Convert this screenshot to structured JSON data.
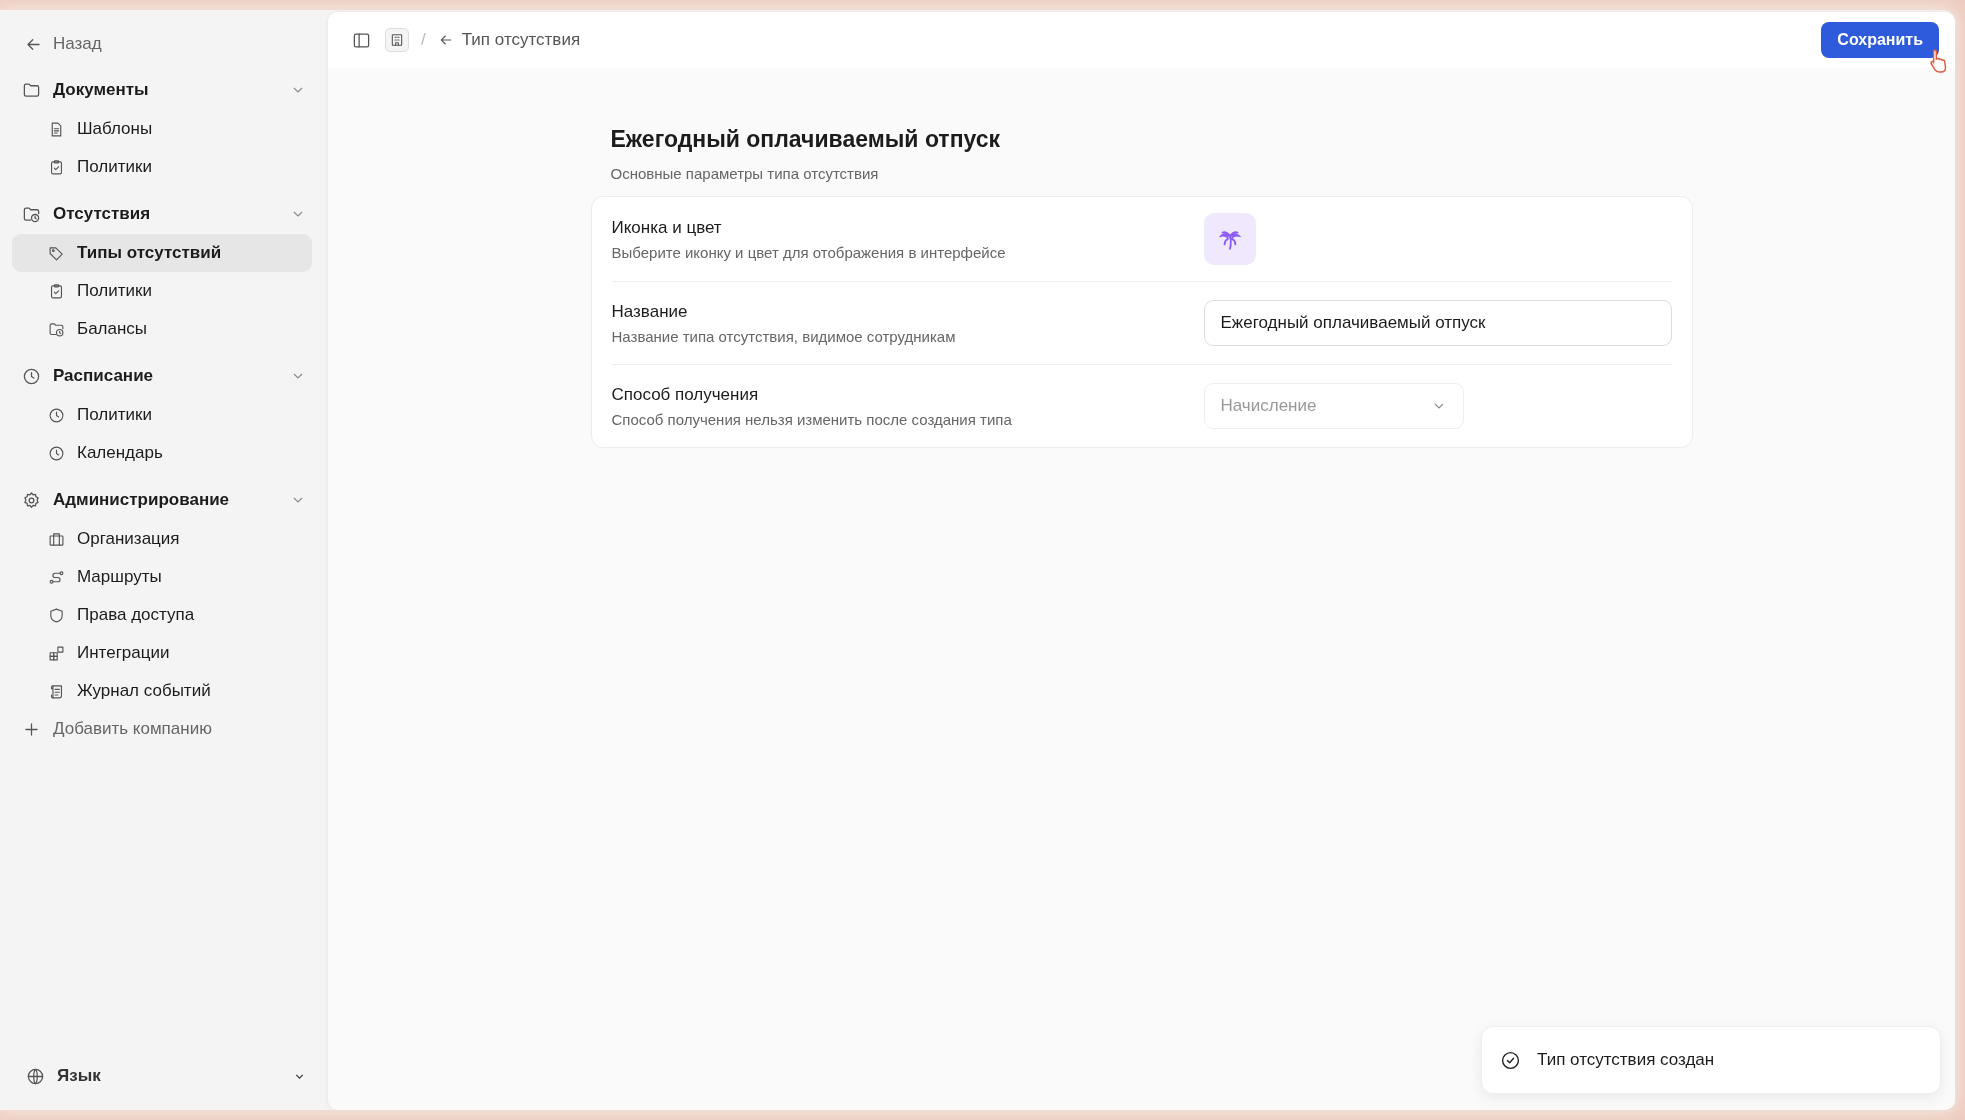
{
  "sidebar": {
    "back": "Назад",
    "groups": [
      {
        "label": "Документы",
        "expanded": true,
        "children": [
          {
            "label": "Шаблоны",
            "selected": false
          },
          {
            "label": "Политики",
            "selected": false
          }
        ]
      },
      {
        "label": "Отсутствия",
        "expanded": true,
        "children": [
          {
            "label": "Типы отсутствий",
            "selected": true
          },
          {
            "label": "Политики",
            "selected": false
          },
          {
            "label": "Балансы",
            "selected": false
          }
        ]
      },
      {
        "label": "Расписание",
        "expanded": true,
        "children": [
          {
            "label": "Политики",
            "selected": false
          },
          {
            "label": "Календарь",
            "selected": false
          }
        ]
      },
      {
        "label": "Администрирование",
        "expanded": true,
        "children": [
          {
            "label": "Организация",
            "selected": false
          },
          {
            "label": "Маршруты",
            "selected": false
          },
          {
            "label": "Права доступа",
            "selected": false
          },
          {
            "label": "Интеграции",
            "selected": false
          },
          {
            "label": "Журнал событий",
            "selected": false
          }
        ]
      }
    ],
    "add_company": "Добавить компанию",
    "language": "Язык"
  },
  "topbar": {
    "separator": "/",
    "breadcrumb": "Тип отсутствия",
    "save_button": "Сохранить"
  },
  "header": {
    "title": "Ежегодный оплачиваемый отпуск",
    "subtitle": "Основные параметры типа отсутствия"
  },
  "fields": [
    {
      "kind": "icon",
      "label": "Иконка и цвет",
      "hint": "Выберите иконку и цвет для отображения в интерфейсе",
      "color": "#8b5cf6"
    },
    {
      "kind": "text",
      "label": "Название",
      "hint": "Название типа отсутствия, видимое сотрудникам",
      "value": "Ежегодный оплачиваемый отпуск"
    },
    {
      "kind": "select",
      "label": "Способ получения",
      "hint": "Способ получения нельзя изменить после создания типа",
      "value": "Начисление",
      "disabled": true
    }
  ],
  "toast": {
    "message": "Тип отсутствия создан"
  }
}
